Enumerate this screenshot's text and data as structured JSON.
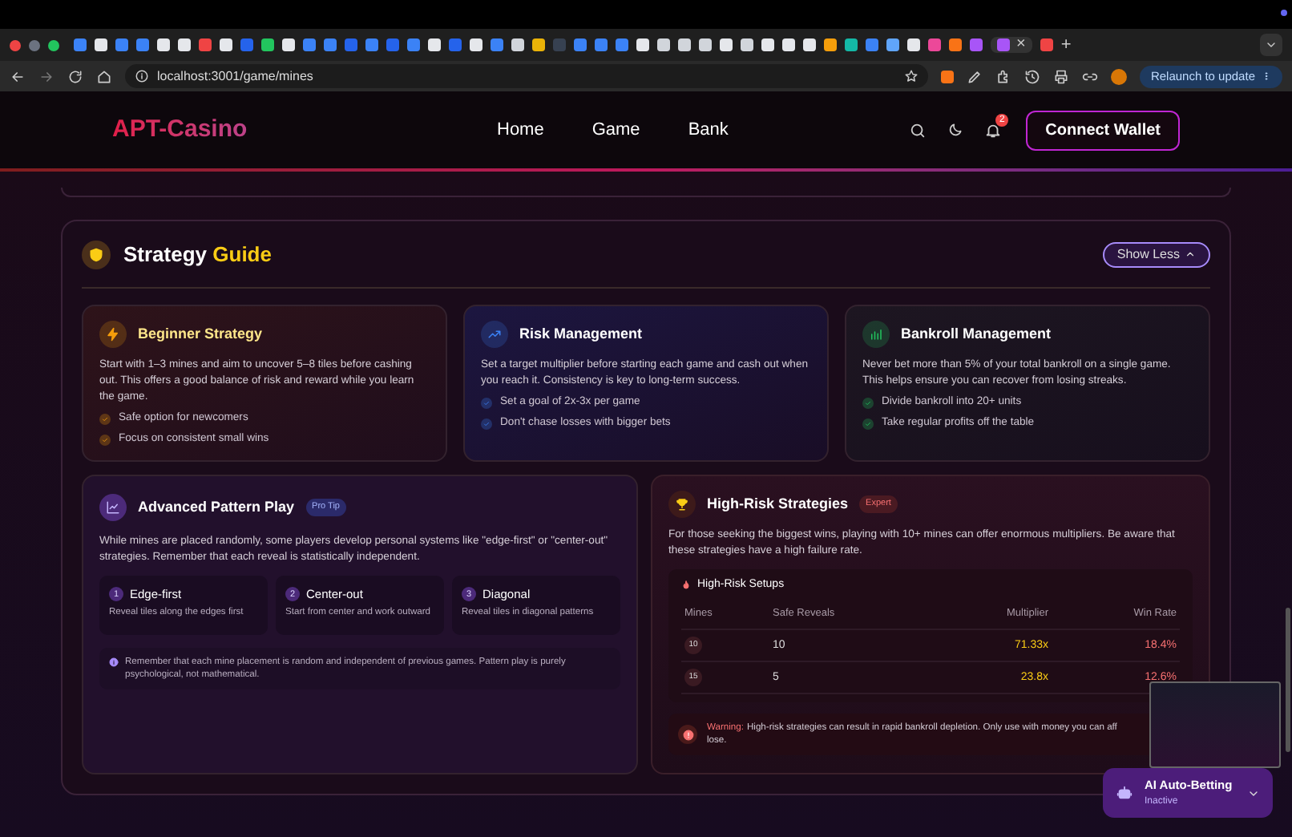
{
  "browser": {
    "tab_close": "×",
    "new_tab": "+",
    "url": "localhost:3001/game/mines",
    "relaunch": "Relaunch to update"
  },
  "nav": {
    "logo": "APT-Casino",
    "links": [
      {
        "label": "Home"
      },
      {
        "label": "Game"
      },
      {
        "label": "Bank"
      }
    ],
    "notification_count": "2",
    "connect": "Connect Wallet"
  },
  "guide": {
    "title": "Strategy",
    "title_accent": "Guide",
    "toggle": "Show Less",
    "cards": [
      {
        "kind": "bolt",
        "color": "#f59e0b",
        "title": "Beginner Strategy",
        "text": "Start with 1–3 mines and aim to uncover 5–8 tiles before cashing out. This offers a good balance of risk and reward while you learn the game.",
        "bullets": [
          "Safe option for newcomers",
          "Focus on consistent small wins"
        ]
      },
      {
        "kind": "trend",
        "color": "#3b82f6",
        "title": "Risk Management",
        "text": "Set a target multiplier before starting each game and cash out when you reach it. Consistency is key to long-term success.",
        "bullets": [
          "Set a goal of 2x-3x per game",
          "Don't chase losses with bigger bets"
        ]
      },
      {
        "kind": "bars",
        "color": "#22c55e",
        "title": "Bankroll Management",
        "text": "Never bet more than 5% of your total bankroll on a single game. This helps ensure you can recover from losing streaks.",
        "bullets": [
          "Divide bankroll into 20+ units",
          "Take regular profits off the table"
        ]
      }
    ],
    "advanced": {
      "title": "Advanced Pattern Play",
      "badge": "Pro Tip",
      "text": "While mines are placed randomly, some players develop personal systems like \"edge-first\" or \"center-out\" strategies. Remember that each reveal is statistically independent.",
      "patterns": [
        {
          "number": "1",
          "title": "Edge-first",
          "text": "Reveal tiles along the edges first"
        },
        {
          "number": "2",
          "title": "Center-out",
          "text": "Start from center and work outward"
        },
        {
          "number": "3",
          "title": "Diagonal",
          "text": "Reveal tiles in diagonal patterns"
        }
      ],
      "note": "Remember that each mine placement is random and independent of previous games. Pattern play is purely psychological, not mathematical."
    },
    "high_risk": {
      "title": "High-Risk Strategies",
      "badge": "Expert",
      "text": "For those seeking the biggest wins, playing with 10+ mines can offer enormous multipliers. Be aware that these strategies have a high failure rate.",
      "table_title": "High-Risk Setups",
      "columns": [
        "Mines",
        "Safe Reveals",
        "Multiplier",
        "Win Rate"
      ],
      "rows": [
        [
          "10",
          "10",
          "71.33x",
          "18.4%"
        ],
        [
          "15",
          "5",
          "23.8x",
          "12.6%"
        ]
      ],
      "warning_label": "Warning:",
      "warning_text": "High-risk strategies can result in rapid bankroll depletion. Only use with money you can aff",
      "warning_text_2": "lose."
    }
  },
  "ai": {
    "title": "AI Auto-Betting",
    "status": "Inactive"
  }
}
